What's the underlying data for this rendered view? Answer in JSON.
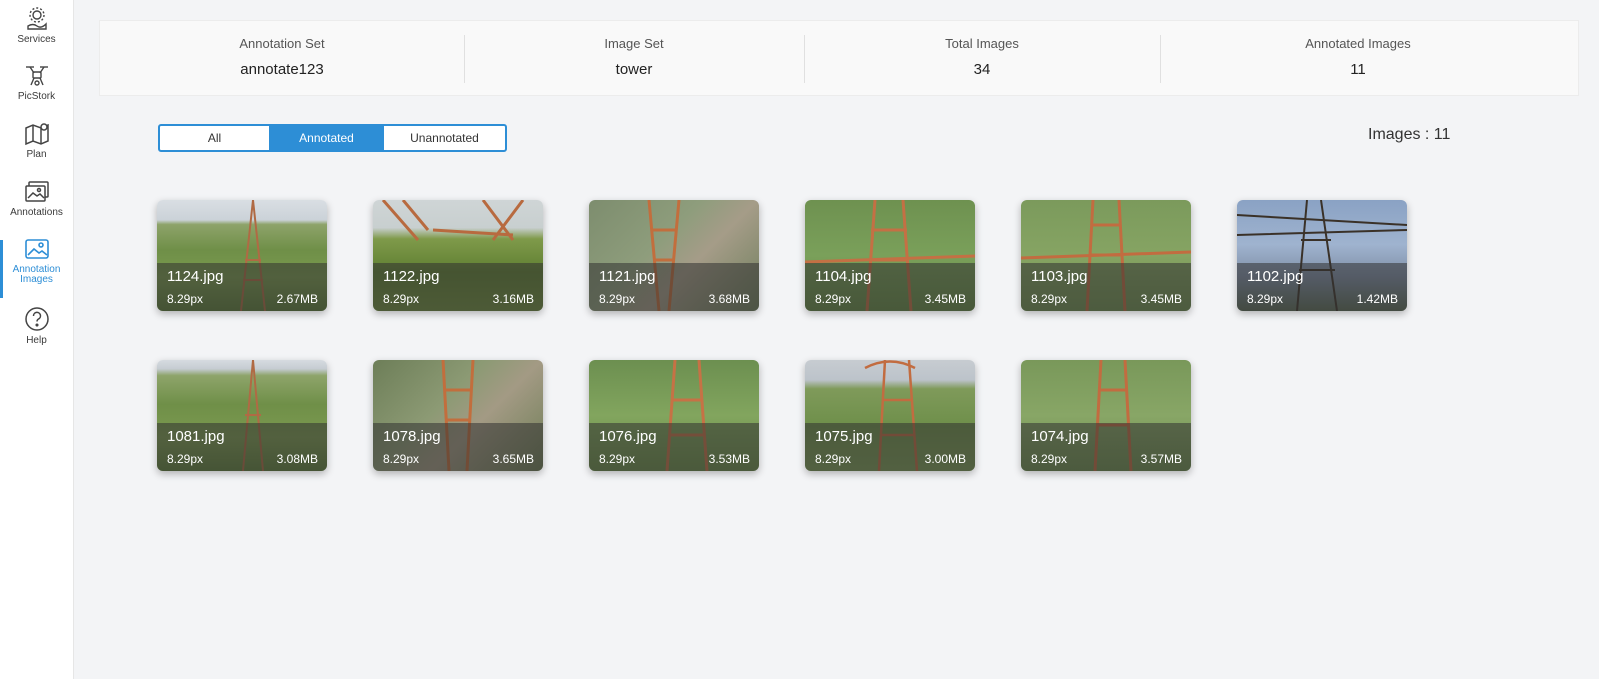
{
  "sidebar": {
    "items": [
      {
        "label": "Services",
        "icon": "services-icon"
      },
      {
        "label": "PicStork",
        "icon": "drone-icon"
      },
      {
        "label": "Plan",
        "icon": "map-icon"
      },
      {
        "label": "Annotations",
        "icon": "annotations-icon"
      },
      {
        "label": "Annotation\nImages",
        "label1": "Annotation",
        "label2": "Images",
        "icon": "image-icon",
        "active": true
      },
      {
        "label": "Help",
        "icon": "help-icon"
      }
    ]
  },
  "stats": {
    "annotation_set": {
      "label": "Annotation Set",
      "value": "annotate123"
    },
    "image_set": {
      "label": "Image Set",
      "value": "tower"
    },
    "total_images": {
      "label": "Total Images",
      "value": "34"
    },
    "annotated_images": {
      "label": "Annotated Images",
      "value": "11"
    }
  },
  "filter": {
    "all": "All",
    "annotated": "Annotated",
    "unannotated": "Unannotated",
    "selected": "Annotated"
  },
  "images_count": "Images : 11",
  "images": [
    {
      "name": "1124.jpg",
      "resolution": "8.29px",
      "size": "2.67MB"
    },
    {
      "name": "1122.jpg",
      "resolution": "8.29px",
      "size": "3.16MB"
    },
    {
      "name": "1121.jpg",
      "resolution": "8.29px",
      "size": "3.68MB"
    },
    {
      "name": "1104.jpg",
      "resolution": "8.29px",
      "size": "3.45MB"
    },
    {
      "name": "1103.jpg",
      "resolution": "8.29px",
      "size": "3.45MB"
    },
    {
      "name": "1102.jpg",
      "resolution": "8.29px",
      "size": "1.42MB"
    },
    {
      "name": "1081.jpg",
      "resolution": "8.29px",
      "size": "3.08MB"
    },
    {
      "name": "1078.jpg",
      "resolution": "8.29px",
      "size": "3.65MB"
    },
    {
      "name": "1076.jpg",
      "resolution": "8.29px",
      "size": "3.53MB"
    },
    {
      "name": "1075.jpg",
      "resolution": "8.29px",
      "size": "3.00MB"
    },
    {
      "name": "1074.jpg",
      "resolution": "8.29px",
      "size": "3.57MB"
    }
  ],
  "colors": {
    "accent": "#2d8ed6",
    "background": "#f3f4f6"
  }
}
